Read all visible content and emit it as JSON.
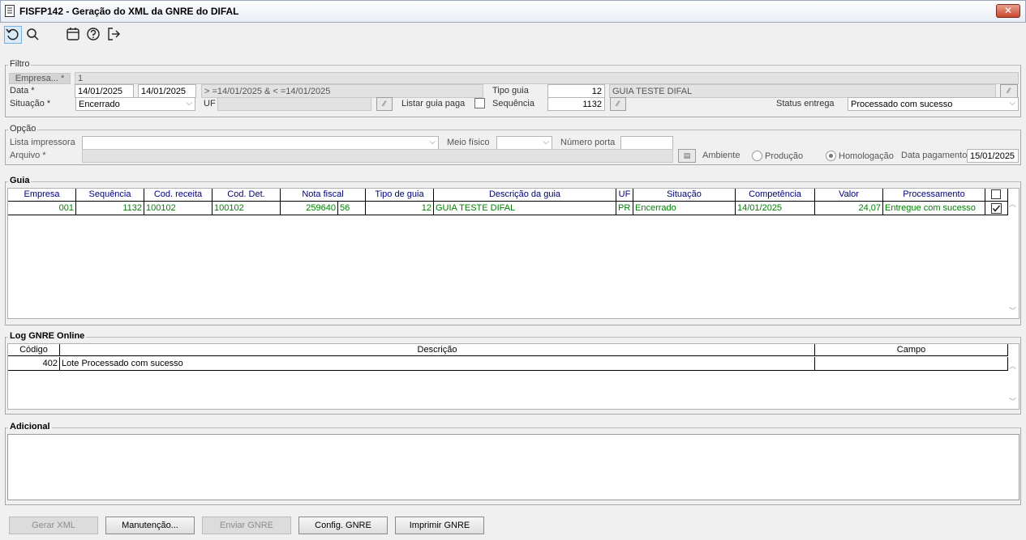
{
  "window": {
    "title": "FISFP142 - Geração do XML da GNRE do DIFAL",
    "close_glyph": "✕"
  },
  "toolbar": {
    "icons": [
      "refresh-icon",
      "search-icon",
      "calendar-icon",
      "help-icon",
      "exit-icon"
    ]
  },
  "filtro": {
    "title": "Filtro",
    "empresa_label": "Empresa... *",
    "empresa_value": "1",
    "data_label": "Data *",
    "data_inicio": "14/01/2025",
    "data_fim": "14/01/2025",
    "data_expr": "> =14/01/2025 & < =14/01/2025",
    "tipo_guia_label": "Tipo guia",
    "tipo_guia_value": "12",
    "tipo_guia_desc": "GUIA TESTE DIFAL",
    "situacao_label": "Situação *",
    "situacao_value": "Encerrado",
    "uf_label": "UF",
    "uf_value": "",
    "listar_label": "Listar guia paga",
    "sequencia_label": "Sequência",
    "sequencia_value": "1132",
    "status_label": "Status entrega",
    "status_value": "Processado com sucesso"
  },
  "opcao": {
    "title": "Opção",
    "impressora_label": "Lista impressora",
    "impressora_value": "",
    "meio_label": "Meio físico",
    "meio_value": "",
    "porta_label": "Número porta",
    "porta_value": "",
    "arquivo_label": "Arquivo *",
    "arquivo_value": "",
    "ambiente_label": "Ambiente",
    "producao_label": "Produção",
    "homologacao_label": "Homologação",
    "pagamento_label": "Data pagamento",
    "pagamento_value": "15/01/2025"
  },
  "guia": {
    "title": "Guia",
    "headers": [
      "Empresa",
      "Sequência",
      "Cod. receita",
      "Cod. Det.",
      "Nota fiscal",
      "Tipo de guia",
      "Descrição da guia",
      "UF",
      "Situação",
      "Competência",
      "Valor",
      "Processamento"
    ],
    "row": {
      "empresa": "001",
      "sequencia": "1132",
      "cod_receita": "100102",
      "cod_det": "100102",
      "nota_fiscal": "259640",
      "nota_serie": "56",
      "tipo_guia": "12",
      "descricao": "GUIA TESTE DIFAL",
      "uf": "PR",
      "situacao": "Encerrado",
      "competencia": "14/01/2025",
      "valor": "24,07",
      "processamento": "Entregue com sucesso",
      "checked": true
    }
  },
  "log": {
    "title": "Log GNRE Online",
    "headers": [
      "Código",
      "Descrição",
      "Campo"
    ],
    "row": {
      "codigo": "402",
      "descricao": "Lote Processado com sucesso",
      "campo": ""
    }
  },
  "adicional": {
    "title": "Adicional",
    "value": ""
  },
  "buttons": {
    "gerar": "Gerar XML",
    "manutencao": "Manutenção...",
    "enviar": "Enviar GNRE",
    "config": "Config. GNRE",
    "imprimir": "Imprimir GNRE"
  }
}
